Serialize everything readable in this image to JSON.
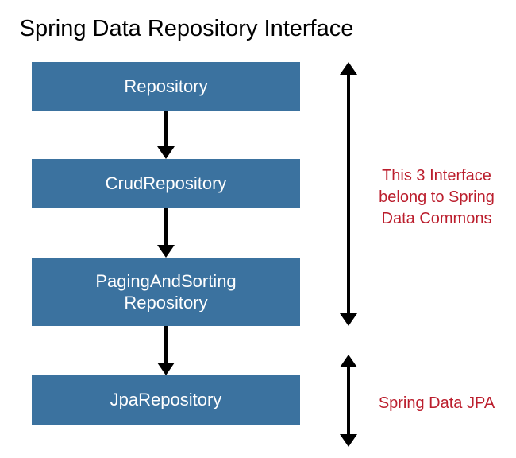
{
  "title": "Spring Data Repository Interface",
  "boxes": {
    "b1": "Repository",
    "b2": "CrudRepository",
    "b3_line1": "PagingAndSorting",
    "b3_line2": "Repository",
    "b4": "JpaRepository"
  },
  "annotations": {
    "a1_line1": "This 3 Interface",
    "a1_line2": "belong to Spring",
    "a1_line3": "Data Commons",
    "a2": "Spring Data JPA"
  },
  "colors": {
    "box_bg": "#3b729f",
    "annotation": "#bb1e2d"
  }
}
